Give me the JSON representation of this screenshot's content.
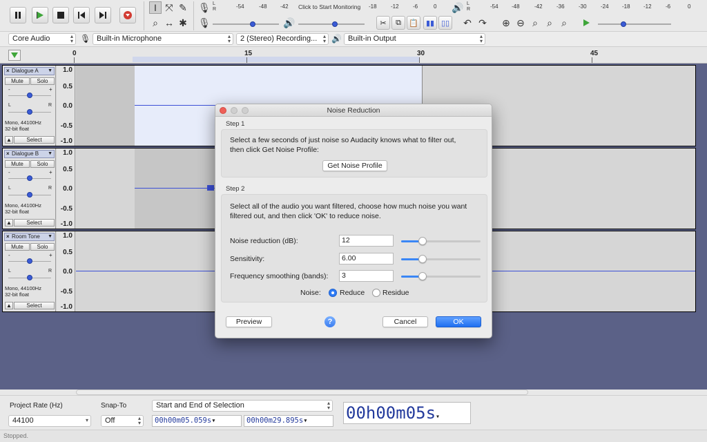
{
  "toolbar": {
    "monitor_label": "Click to Start Monitoring",
    "meter_scale_rec": [
      "-54",
      "-48",
      "-42",
      "-18",
      "-12",
      "-6",
      "0"
    ],
    "meter_scale_play": [
      "-54",
      "-48",
      "-42",
      "-36",
      "-30",
      "-24",
      "-18",
      "-12",
      "-6",
      "0"
    ],
    "channel_l": "L",
    "channel_r": "R",
    "recording_volume": 0.6,
    "playback_volume": 0.55,
    "play_speed": 0.35,
    "colors": {
      "record_red": "#d23c33",
      "play_green": "#3fa63a",
      "accent_blue": "#3b5bd6"
    }
  },
  "devices": {
    "host": "Core Audio",
    "recording_device": "Built-in Microphone",
    "channels": "2 (Stereo) Recording...",
    "playback_device": "Built-in Output"
  },
  "timeline": {
    "labels": [
      "0",
      "15",
      "30",
      "45"
    ]
  },
  "tracks": [
    {
      "name": "Dialogue A",
      "mute": "Mute",
      "solo": "Solo",
      "gain_l": "-",
      "gain_r": "+",
      "pan_l": "L",
      "pan_r": "R",
      "info1": "Mono, 44100Hz",
      "info2": "32-bit float",
      "select": "Select",
      "scale": [
        "1.0",
        "0.5",
        "0.0",
        "-0.5",
        "-1.0"
      ]
    },
    {
      "name": "Dialogue B",
      "mute": "Mute",
      "solo": "Solo",
      "gain_l": "-",
      "gain_r": "+",
      "pan_l": "L",
      "pan_r": "R",
      "info1": "Mono, 44100Hz",
      "info2": "32-bit float",
      "select": "Select",
      "scale": [
        "1.0",
        "0.5",
        "0.0",
        "-0.5",
        "-1.0"
      ]
    },
    {
      "name": "Room Tone",
      "mute": "Mute",
      "solo": "Solo",
      "gain_l": "-",
      "gain_r": "+",
      "pan_l": "L",
      "pan_r": "R",
      "info1": "Mono, 44100Hz",
      "info2": "32-bit float",
      "select": "Select",
      "scale": [
        "1.0",
        "0.5",
        "0.0",
        "-0.5",
        "-1.0"
      ]
    }
  ],
  "dialog": {
    "title": "Noise Reduction",
    "step1_label": "Step 1",
    "step1_text_line1": "Select a few seconds of just noise so Audacity knows what to filter out,",
    "step1_text_line2": "then click Get Noise Profile:",
    "get_profile_button": "Get Noise Profile",
    "step2_label": "Step 2",
    "step2_text_line1": "Select all of the audio you want filtered, choose how much noise you want",
    "step2_text_line2": "filtered out, and then click 'OK' to reduce noise.",
    "noise_reduction_label": "Noise reduction (dB):",
    "noise_reduction_value": "12",
    "noise_reduction_slider": 0.27,
    "sensitivity_label": "Sensitivity:",
    "sensitivity_value": "6.00",
    "sensitivity_slider": 0.27,
    "freq_smoothing_label": "Frequency smoothing (bands):",
    "freq_smoothing_value": "3",
    "freq_smoothing_slider": 0.27,
    "noise_label": "Noise:",
    "reduce_label": "Reduce",
    "residue_label": "Residue",
    "preview_button": "Preview",
    "help_button": "?",
    "cancel_button": "Cancel",
    "ok_button": "OK"
  },
  "bottom": {
    "project_rate_label": "Project Rate (Hz)",
    "project_rate_value": "44100",
    "snap_to_label": "Snap-To",
    "snap_to_value": "Off",
    "selection_mode": "Start and End of Selection",
    "selection_start": "00h00m05.059s",
    "selection_end": "00h00m29.895s",
    "audio_position": "00h00m05s"
  },
  "status": {
    "text": "Stopped."
  }
}
